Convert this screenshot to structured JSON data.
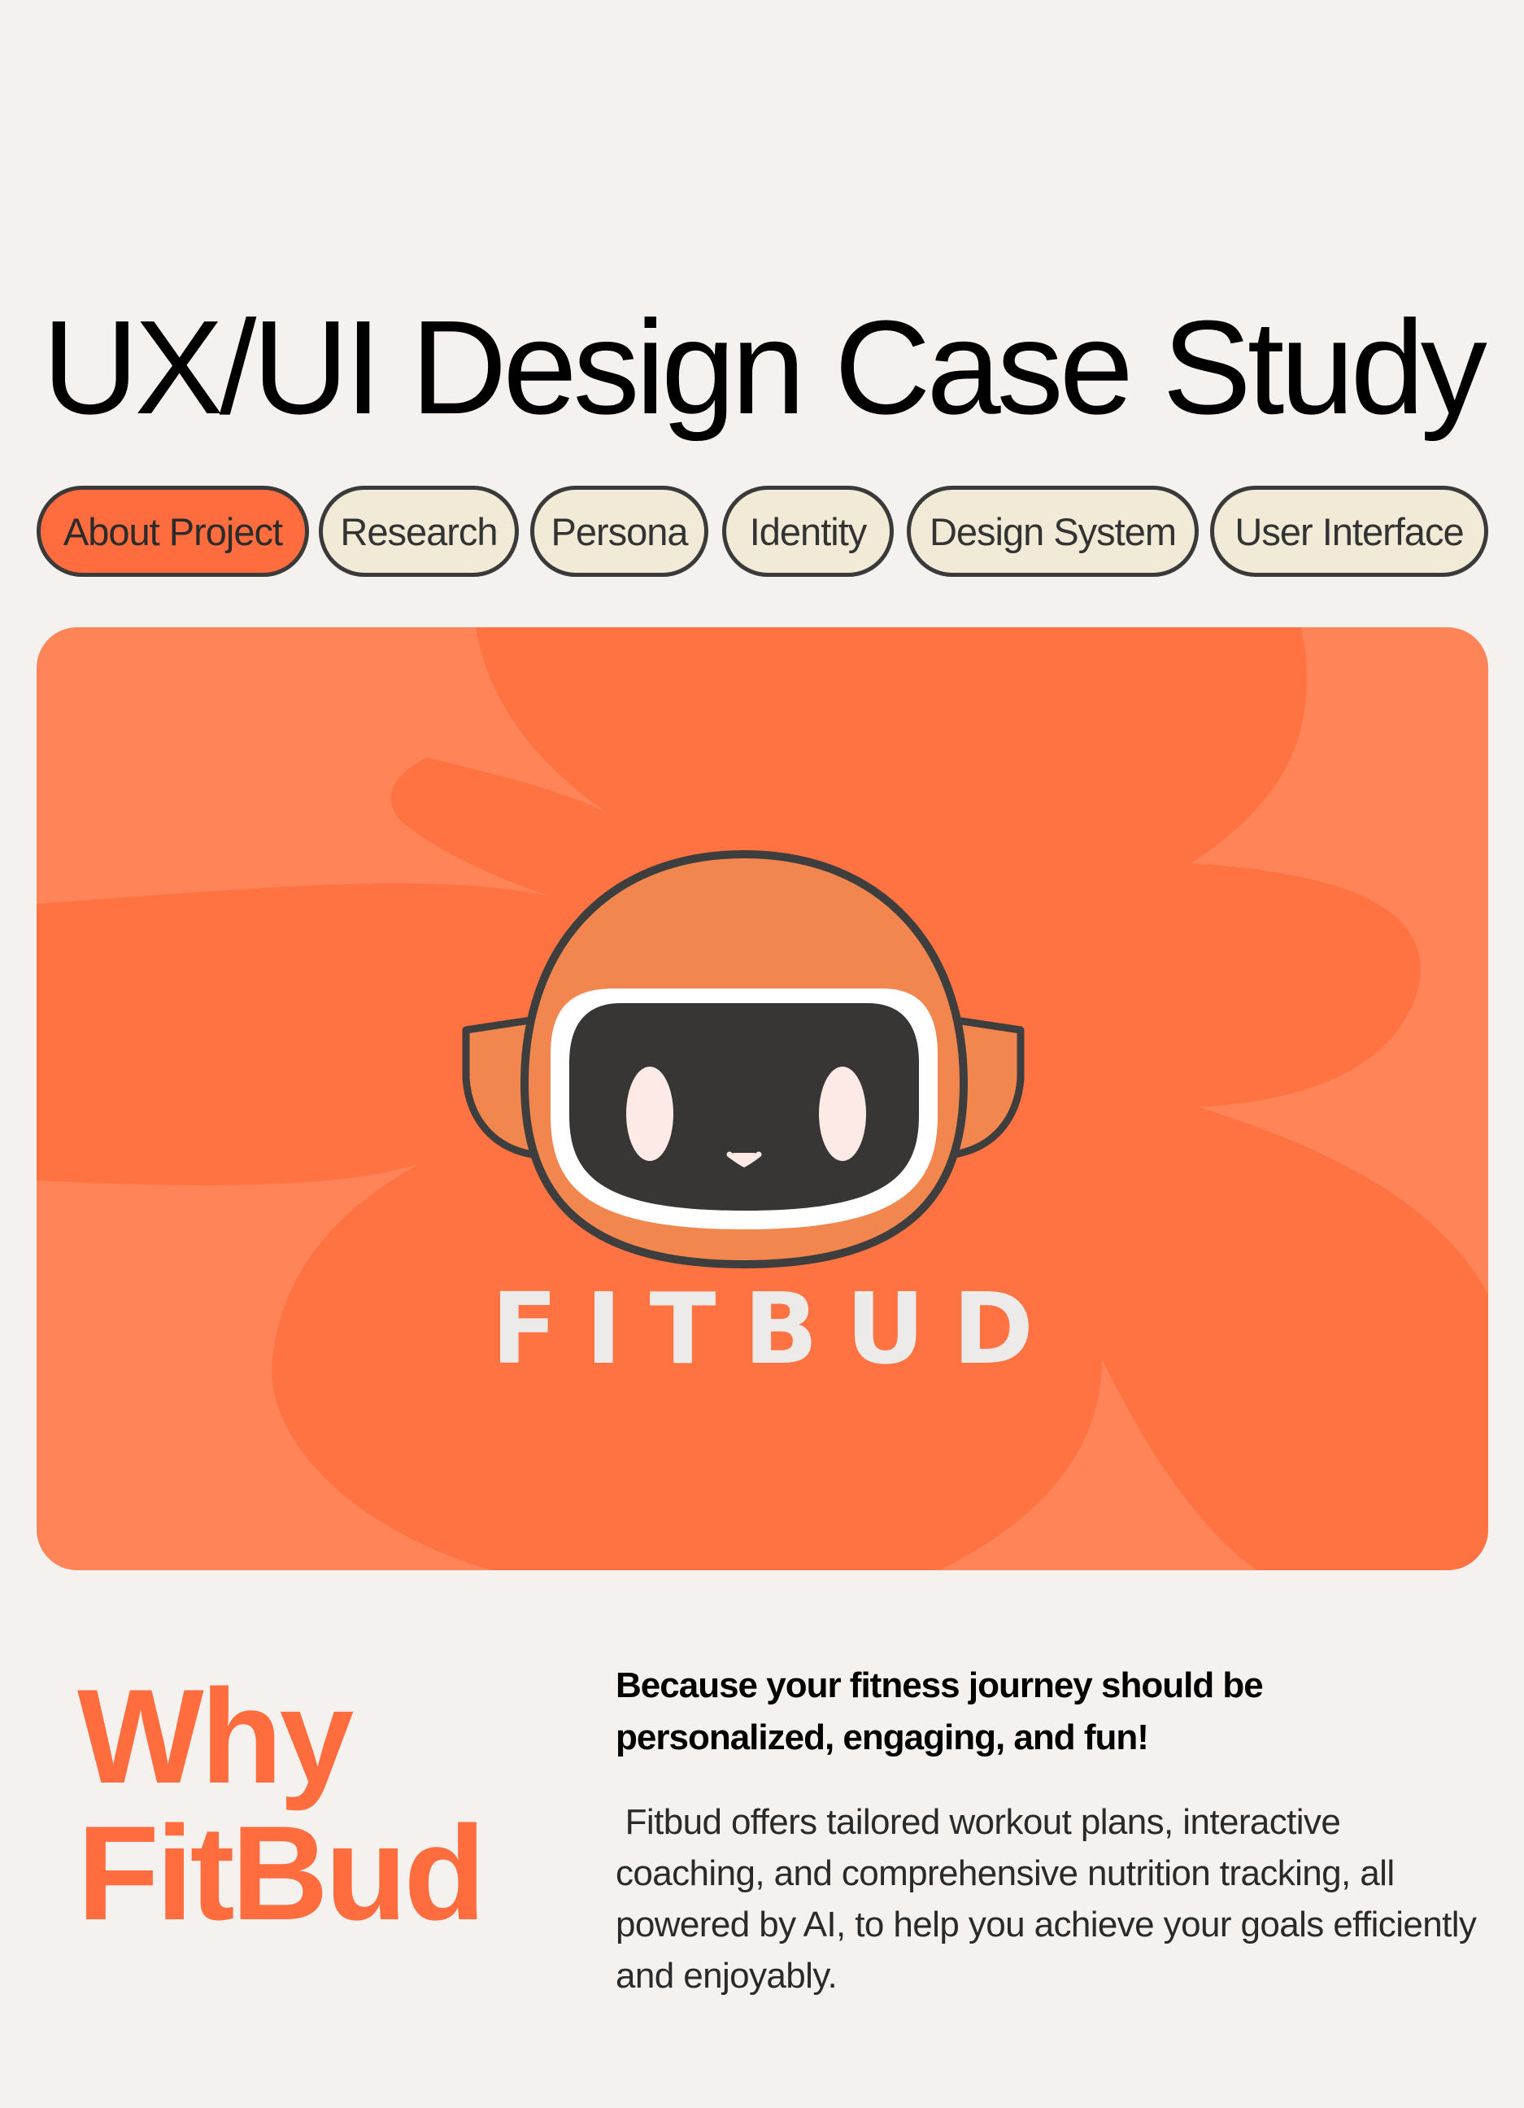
{
  "page": {
    "title": "UX/UI Design Case Study"
  },
  "tabs": [
    {
      "label": "About Project",
      "active": true
    },
    {
      "label": "Research",
      "active": false
    },
    {
      "label": "Persona",
      "active": false
    },
    {
      "label": "Identity",
      "active": false
    },
    {
      "label": "Design System",
      "active": false
    },
    {
      "label": "User Interface",
      "active": false
    }
  ],
  "hero": {
    "brand_name": "FITBUD",
    "mascot_icon": "robot-mascot-icon"
  },
  "why_section": {
    "heading_line1": "Why",
    "heading_line2": "FitBud",
    "lead": "Because your fitness journey should be personalized, engaging, and fun!",
    "body": " Fitbud offers tailored workout plans, interactive coaching, and comprehensive nutrition tracking, all powered by AI, to help you achieve your goals efficiently and enjoyably."
  },
  "colors": {
    "background": "#f5f1ee",
    "accent": "#ff6d3f",
    "hero_background": "#ff8457",
    "hero_shape": "#ff7343",
    "tab_background": "#f1ead6",
    "tab_border": "#3a3a3a",
    "mascot_face": "#373635",
    "wordmark": "#ecebe9"
  }
}
